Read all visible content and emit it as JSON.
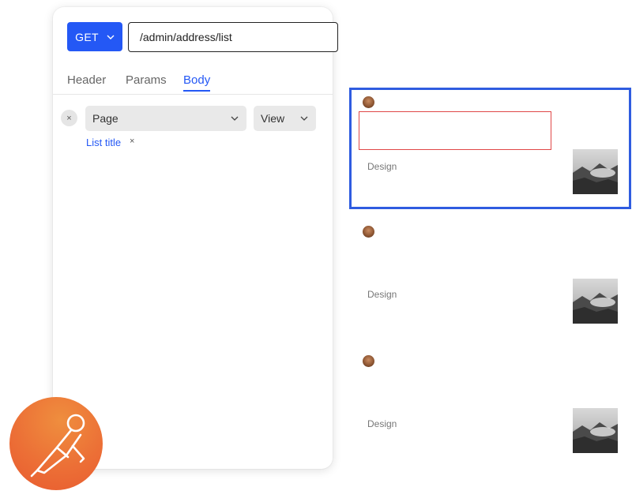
{
  "request": {
    "method": "GET",
    "url": "/admin/address/list"
  },
  "tabs": [
    {
      "label": "Header",
      "active": false
    },
    {
      "label": "Params",
      "active": false
    },
    {
      "label": "Body",
      "active": true
    }
  ],
  "body_row": {
    "field_select": "Page",
    "mode_select": "View",
    "chip_label": "List title",
    "chip_remove": "×",
    "remove_icon": "×"
  },
  "cards": [
    {
      "category": "Design",
      "highlighted": true
    },
    {
      "category": "Design",
      "highlighted": false
    },
    {
      "category": "Design",
      "highlighted": false
    }
  ],
  "colors": {
    "accent": "#2458f5",
    "highlight_border": "#2f5ce0",
    "selection_red": "#e04848",
    "logo_orange": "#ec6f36"
  }
}
